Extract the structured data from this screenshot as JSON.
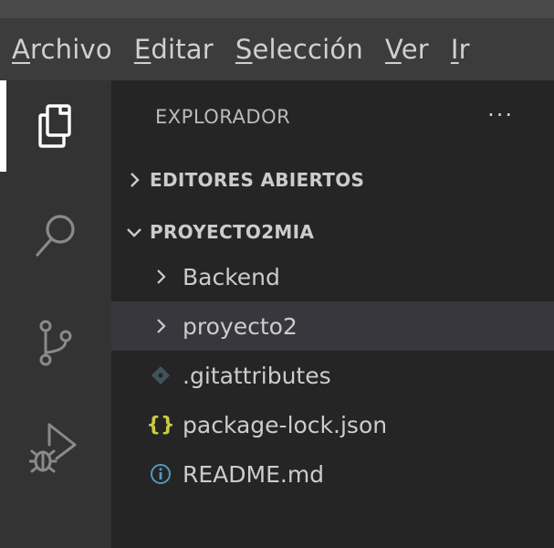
{
  "menubar": {
    "items": [
      {
        "mnemonic": "A",
        "rest": "rchivo"
      },
      {
        "mnemonic": "E",
        "rest": "ditar"
      },
      {
        "mnemonic": "S",
        "rest": "elección"
      },
      {
        "mnemonic": "V",
        "rest": "er"
      },
      {
        "mnemonic": "I",
        "rest": "r"
      }
    ]
  },
  "activity": {
    "items": [
      "explorer-icon",
      "search-icon",
      "source-control-icon",
      "run-debug-icon"
    ]
  },
  "sidebar": {
    "title": "EXPLORADOR",
    "more": "···",
    "sections": {
      "open_editors": "EDITORES ABIERTOS",
      "project": "PROYECTO2MIA"
    },
    "files": [
      {
        "type": "folder",
        "name": "Backend",
        "icon": "chevron-right-icon"
      },
      {
        "type": "folder",
        "name": "proyecto2",
        "icon": "chevron-right-icon",
        "selected": true
      },
      {
        "type": "file",
        "name": ".gitattributes",
        "icon": "git-diamond-icon",
        "icon_color": "#41535b"
      },
      {
        "type": "file",
        "name": "package-lock.json",
        "icon": "json-braces-icon",
        "glyph": "{}",
        "icon_color": "#cbcb41"
      },
      {
        "type": "file",
        "name": "README.md",
        "icon": "info-icon",
        "icon_color": "#519aba"
      }
    ]
  },
  "colors": {
    "menubar": "#3c3c3c",
    "activitybar": "#333333",
    "sidebar": "#252526",
    "selection": "#37373d",
    "text": "#cccccc"
  }
}
